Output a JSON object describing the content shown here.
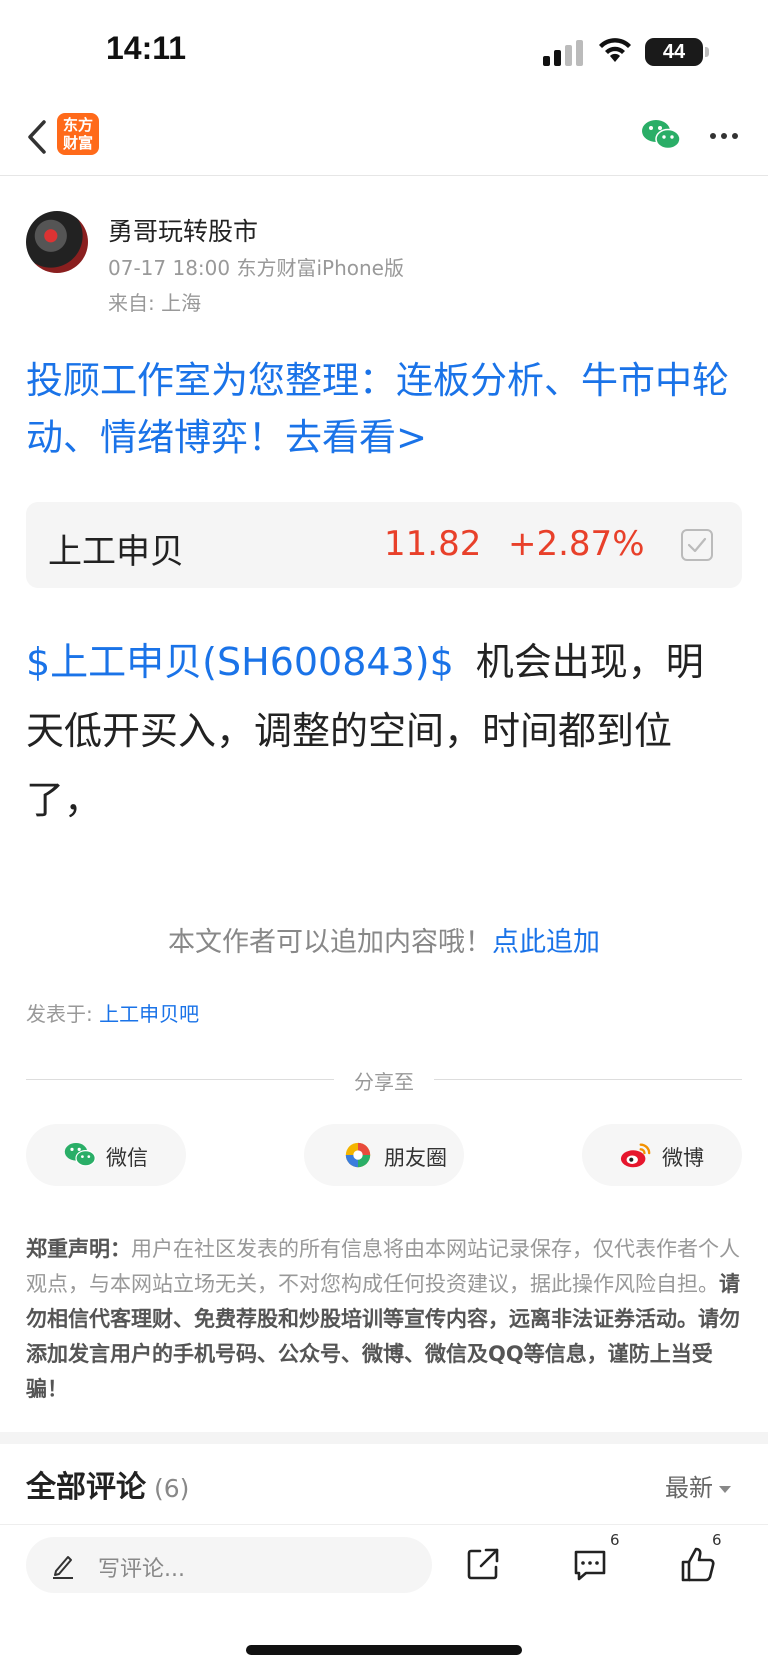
{
  "status_bar": {
    "time": "14:11",
    "battery": "44"
  },
  "nav": {
    "logo_line1": "东方",
    "logo_line2": "财富"
  },
  "author": {
    "name": "勇哥玩转股市",
    "meta": "07-17 18:00 东方财富iPhone版",
    "location": "来自: 上海"
  },
  "promo": {
    "headline": "投顾工作室为您整理：连板分析、牛市中轮动、情绪博弈！去看看>"
  },
  "stock_card": {
    "name": "上工申贝",
    "price": "11.82",
    "change": "+2.87%"
  },
  "post": {
    "stock_link": "$上工申贝(SH600843)$",
    "text": "机会出现，明天低开买入，调整的空间，时间都到位了，"
  },
  "append": {
    "prompt": "本文作者可以追加内容哦！",
    "link": "点此追加"
  },
  "published": {
    "label": "发表于: ",
    "bar": "上工申贝吧"
  },
  "share": {
    "label": "分享至",
    "wechat": "微信",
    "moments": "朋友圈",
    "weibo": "微博"
  },
  "disclaimer": {
    "title": "郑重声明：",
    "text": "用户在社区发表的所有信息将由本网站记录保存，仅代表作者个人观点，与本网站立场无关，不对您构成任何投资建议，据此操作风险自担。",
    "warning": "请勿相信代客理财、免费荐股和炒股培训等宣传内容，远离非法证券活动。请勿添加发言用户的手机号码、公众号、微博、微信及QQ等信息，谨防上当受骗！"
  },
  "comments": {
    "title": "全部评论",
    "count": "(6)",
    "sort": "最新"
  },
  "bottom_bar": {
    "placeholder": "写评论...",
    "comment_count": "6",
    "like_count": "6"
  },
  "colors": {
    "accent_blue": "#1a73e8",
    "price_red": "#e8402a",
    "brand_orange": "#ff6a1a",
    "wechat_green": "#2aae67"
  }
}
